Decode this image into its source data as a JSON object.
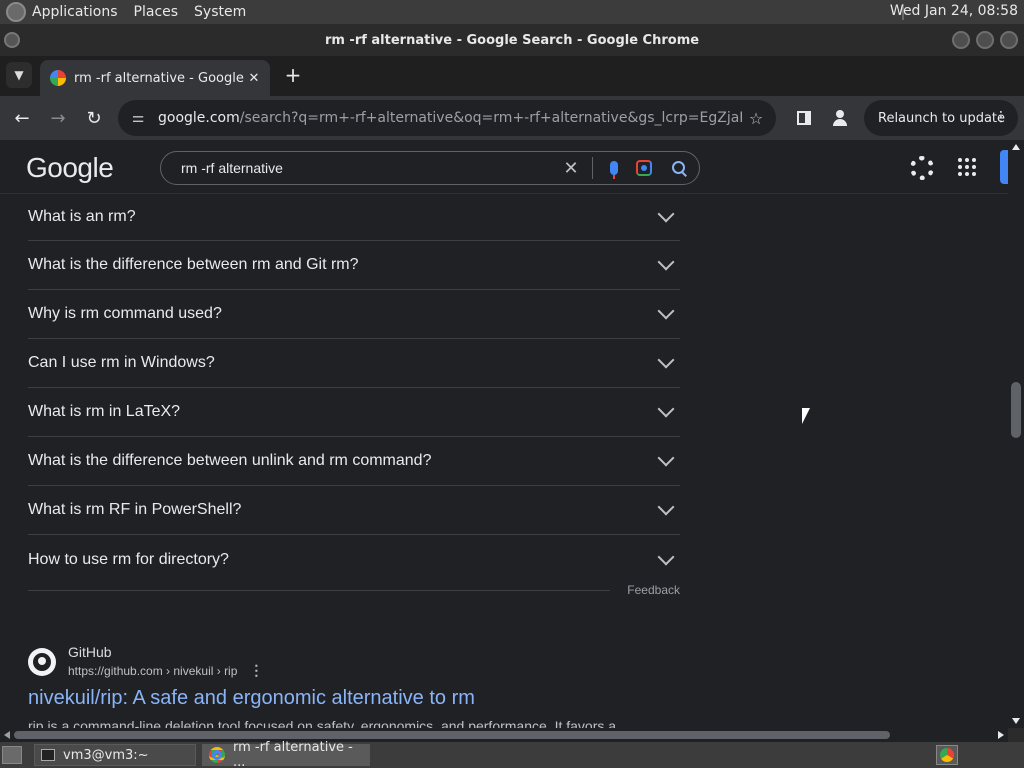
{
  "system_panel": {
    "menus": [
      "Applications",
      "Places",
      "System"
    ],
    "clock": "Wed Jan 24, 08:58"
  },
  "window": {
    "title": "rm -rf alternative - Google Search - Google Chrome"
  },
  "tab": {
    "title": "rm -rf alternative - Google Se",
    "close": "✕",
    "new_tab": "+"
  },
  "toolbar": {
    "url_host": "google.com",
    "url_rest": "/search?q=rm+-rf+alternative&oq=rm+-rf+alternative&gs_lcrp=EgZjaHJvbWUy...",
    "relaunch_label": "Relaunch to update",
    "relaunch_menu": "⋮",
    "back": "←",
    "forward": "→",
    "reload": "↻",
    "star": "☆",
    "tune": "⚌"
  },
  "google": {
    "logo": "Google",
    "query": "rm -rf alternative",
    "clear": "✕"
  },
  "faq": {
    "items": [
      "What is an rm?",
      "What is the difference between rm and Git rm?",
      "Why is rm command used?",
      "Can I use rm in Windows?",
      "What is rm in LaTeX?",
      "What is the difference between unlink and rm command?",
      "What is rm RF in PowerShell?",
      "How to use rm for directory?"
    ],
    "feedback": "Feedback"
  },
  "result": {
    "site_name": "GitHub",
    "breadcrumb": "https://github.com › nivekuil › rip",
    "more": "⋮",
    "title": "nivekuil/rip: A safe and ergonomic alternative to rm",
    "snippet": "rip is a command-line deletion tool focused on safety, ergonomics, and performance. It favors a"
  },
  "taskbar": {
    "terminal": "vm3@vm3:~",
    "chrome": "rm -rf alternative - ..."
  },
  "colors": {
    "page_bg": "#202124",
    "link": "#8ab4f8",
    "text": "#e8eaed"
  },
  "icons": [
    "search-icon",
    "mic-icon",
    "lens-icon",
    "gear-icon",
    "apps-grid-icon",
    "chevron-down-icon",
    "github-icon",
    "star-icon",
    "profile-icon",
    "side-panel-icon"
  ]
}
